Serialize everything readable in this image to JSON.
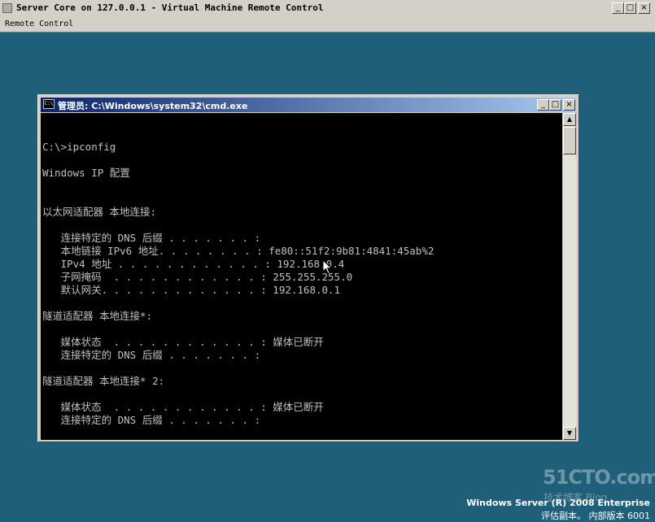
{
  "vm_window": {
    "title": "Server Core on 127.0.0.1 - Virtual Machine Remote Control",
    "menu": [
      "Remote Control"
    ],
    "buttons": {
      "minimize": "_",
      "maximize": "□",
      "close": "×"
    }
  },
  "cmd_window": {
    "title": "管理员: C:\\Windows\\system32\\cmd.exe",
    "buttons": {
      "minimize": "_",
      "maximize": "□",
      "close": "×"
    },
    "console_lines": [
      "C:\\>ipconfig",
      "",
      "Windows IP 配置",
      "",
      "",
      "以太网适配器 本地连接:",
      "",
      "   连接特定的 DNS 后缀 . . . . . . . :",
      "   本地链接 IPv6 地址. . . . . . . . : fe80::51f2:9b81:4841:45ab%2",
      "   IPv4 地址 . . . . . . . . . . . . : 192.168.0.4",
      "   子网掩码  . . . . . . . . . . . . : 255.255.255.0",
      "   默认网关. . . . . . . . . . . . . : 192.168.0.1",
      "",
      "隧道适配器 本地连接*:",
      "",
      "   媒体状态  . . . . . . . . . . . . : 媒体已断开",
      "   连接特定的 DNS 后缀 . . . . . . . :",
      "",
      "隧道适配器 本地连接* 2:",
      "",
      "   媒体状态  . . . . . . . . . . . . : 媒体已断开",
      "   连接特定的 DNS 后缀 . . . . . . . :"
    ],
    "scrollbar": {
      "up": "▲",
      "down": "▼"
    }
  },
  "desktop": {
    "watermark": {
      "logo": "51CTO.com",
      "sub": "技术博客 Blog"
    },
    "os_brand": "Windows Server (R) 2008 Enterprise",
    "os_build": "评估副本。 内部版本 6001"
  }
}
